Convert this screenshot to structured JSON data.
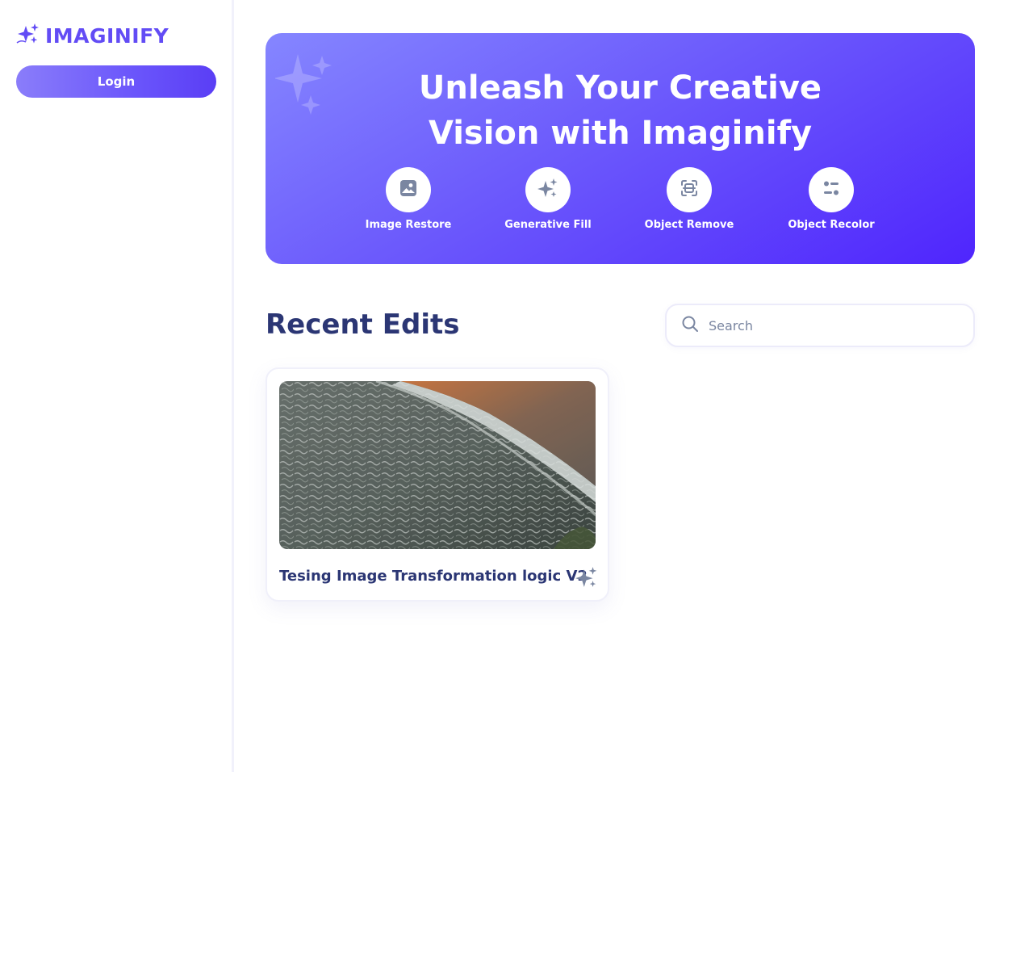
{
  "app": {
    "name": "IMAGINIFY",
    "brand_color": "#624cf5"
  },
  "sidebar": {
    "login_label": "Login"
  },
  "hero": {
    "title_line1": "Unleash Your Creative",
    "title_line2": "Vision with Imaginify",
    "tools": [
      {
        "label": "Image Restore",
        "icon": "image-icon"
      },
      {
        "label": "Generative Fill",
        "icon": "stars-icon"
      },
      {
        "label": "Object Remove",
        "icon": "scan-icon"
      },
      {
        "label": "Object Recolor",
        "icon": "filter-icon"
      }
    ]
  },
  "recent": {
    "title": "Recent Edits",
    "search_placeholder": "Search",
    "items": [
      {
        "title": "Tesing Image Transformation logic V2",
        "icon": "stars-icon",
        "image": "aerial-ocean-waves"
      }
    ]
  },
  "colors": {
    "text_dark": "#2b3674",
    "icon_gray": "#7a86a1",
    "hero_start": "#8586ff",
    "hero_end": "#4f25fd"
  }
}
